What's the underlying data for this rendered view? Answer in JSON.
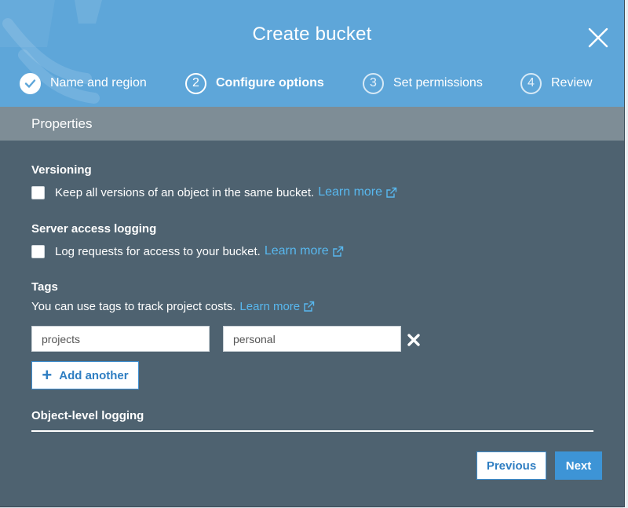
{
  "dialog": {
    "title": "Create bucket"
  },
  "steps": [
    {
      "number": "",
      "label": "Name and region",
      "state": "done"
    },
    {
      "number": "2",
      "label": "Configure options",
      "state": "active"
    },
    {
      "number": "3",
      "label": "Set permissions",
      "state": "pending"
    },
    {
      "number": "4",
      "label": "Review",
      "state": "pending"
    }
  ],
  "properties": {
    "section_title": "Properties",
    "versioning": {
      "heading": "Versioning",
      "checkbox_text": "Keep all versions of an object in the same bucket.",
      "link": "Learn more",
      "checked": false
    },
    "server_access_logging": {
      "heading": "Server access logging",
      "checkbox_text": "Log requests for access to your bucket.",
      "link": "Learn more",
      "checked": false
    },
    "tags": {
      "heading": "Tags",
      "description": "You can use tags to track project costs.",
      "link": "Learn more",
      "key_value": "projects",
      "value_value": "personal",
      "add_button": "Add another"
    },
    "object_level_logging": {
      "heading": "Object-level logging"
    }
  },
  "footer": {
    "previous_label": "Previous",
    "next_label": "Next"
  },
  "colors": {
    "header_blue": "#5ea6d9",
    "body_slate": "#4e6270",
    "section_bar": "#7e8d96",
    "link_blue": "#58b8ef",
    "primary_button": "#3d94d6"
  },
  "icons": {
    "close": "close-icon",
    "step_done": "checkmark-icon",
    "external_link": "external-link-icon",
    "remove_tag": "remove-tag-icon",
    "add": "plus-icon"
  }
}
